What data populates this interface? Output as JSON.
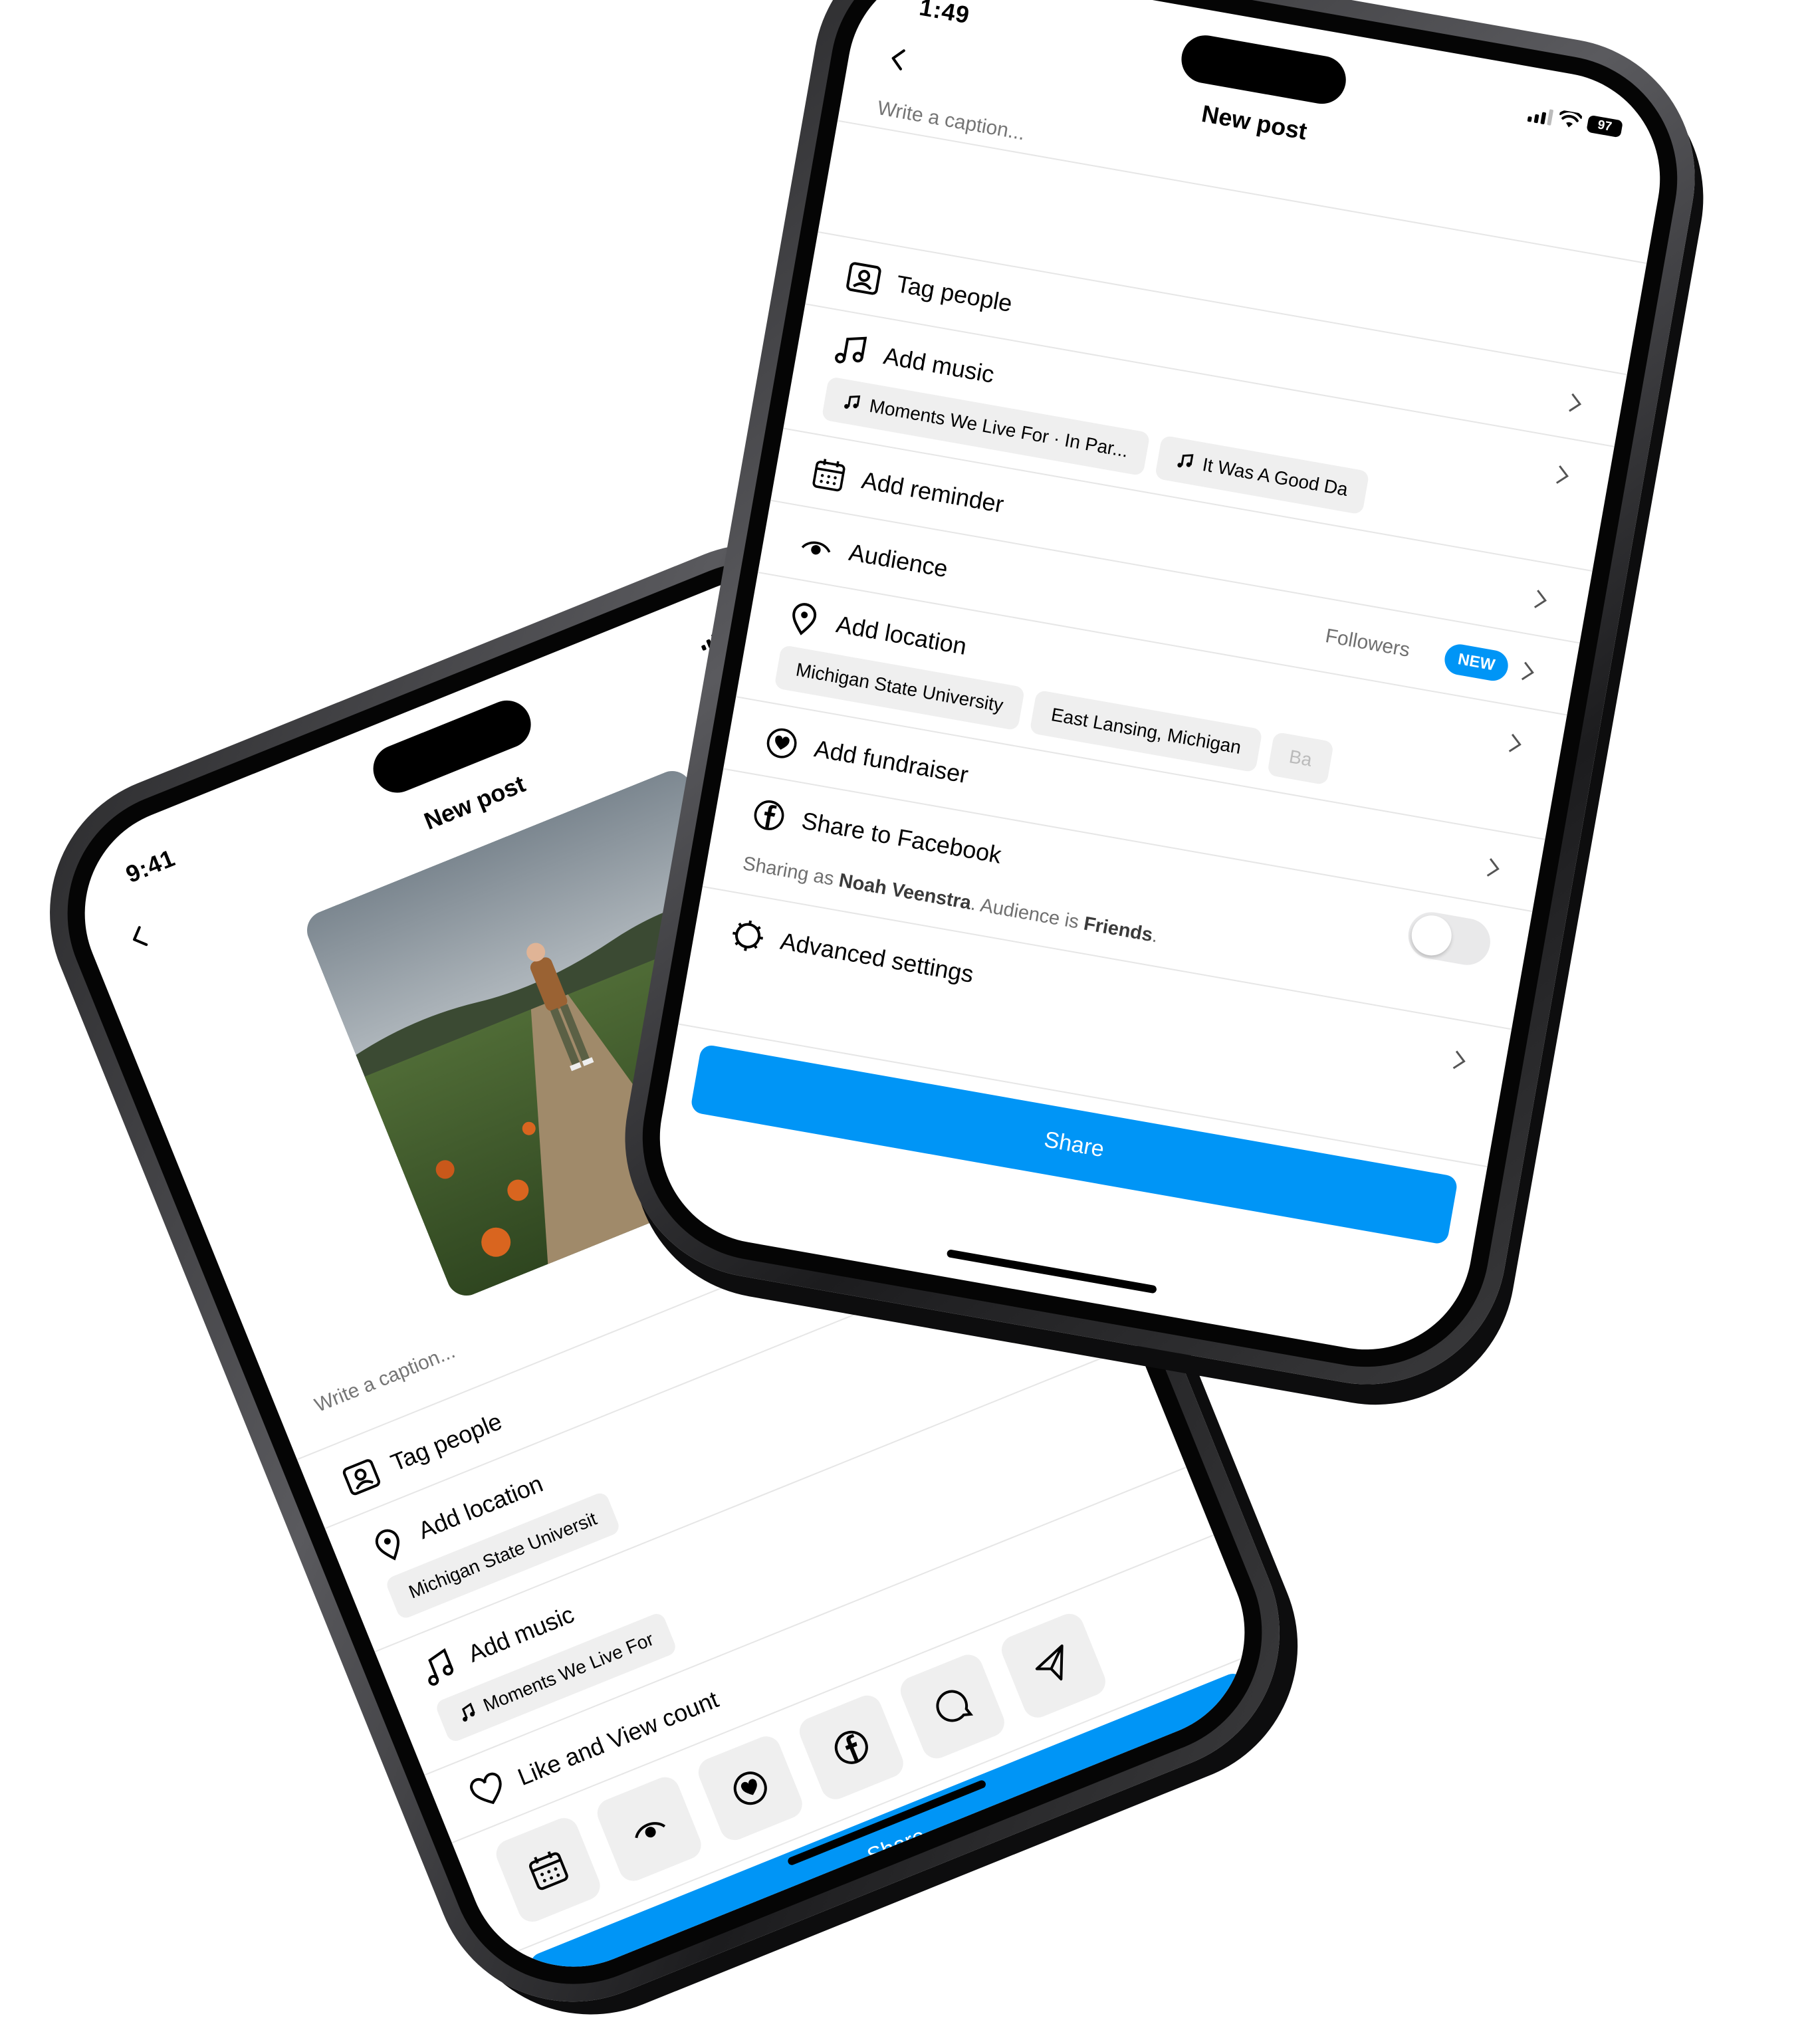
{
  "colors": {
    "accent": "#0095f6",
    "chip_bg": "#efefef",
    "muted": "#8e8e8e"
  },
  "phone_left": {
    "time": "9:41",
    "title": "New post",
    "caption_placeholder": "Write a caption...",
    "tag_people": "Tag people",
    "add_location": "Add location",
    "location_chip": "Michigan State Universit",
    "add_music": "Add music",
    "music_chip": "Moments We Live For",
    "like_view_count": "Like and View count",
    "quick_icons": [
      "calendar-icon",
      "audience-eye-icon",
      "fundraiser-heart-icon",
      "facebook-icon",
      "messenger-icon",
      "send-icon"
    ],
    "share": "Share"
  },
  "phone_right": {
    "time": "1:49",
    "battery": "97",
    "title": "New post",
    "caption_placeholder": "Write a caption...",
    "tag_people": "Tag people",
    "add_music": "Add music",
    "music_chips": [
      "Moments We Live For · In Par...",
      "It Was A Good Da"
    ],
    "add_reminder": "Add reminder",
    "audience": "Audience",
    "audience_value": "Followers",
    "audience_badge": "NEW",
    "add_location": "Add location",
    "location_chips": [
      "Michigan State University",
      "East Lansing, Michigan",
      "Ba"
    ],
    "add_fundraiser": "Add fundraiser",
    "share_to_facebook": "Share to Facebook",
    "sharing_prefix": "Sharing as ",
    "sharing_name": "Noah Veenstra",
    "sharing_mid": ". Audience is ",
    "sharing_audience": "Friends",
    "sharing_suffix": ".",
    "advanced_settings": "Advanced settings",
    "share": "Share"
  }
}
